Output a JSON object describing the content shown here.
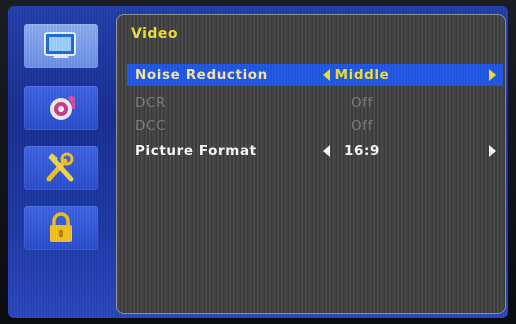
{
  "menu": {
    "title": "Video",
    "sidebar": [
      {
        "icon": "monitor-icon",
        "active": true
      },
      {
        "icon": "speaker-icon",
        "active": false
      },
      {
        "icon": "tools-icon",
        "active": false
      },
      {
        "icon": "lock-icon",
        "active": false
      }
    ],
    "rows": [
      {
        "label": "Noise Reduction",
        "value": "Middle"
      },
      {
        "label": "DCR",
        "value": "Off"
      },
      {
        "label": "DCC",
        "value": "Off"
      },
      {
        "label": "Picture Format",
        "value": "16:9"
      }
    ]
  },
  "colors": {
    "screen_bg": "#2340ad",
    "panel_bg": "#444444",
    "highlight": "#2158e8",
    "title_yellow": "#f2e23b",
    "disabled_gray": "#7e7e7e"
  }
}
